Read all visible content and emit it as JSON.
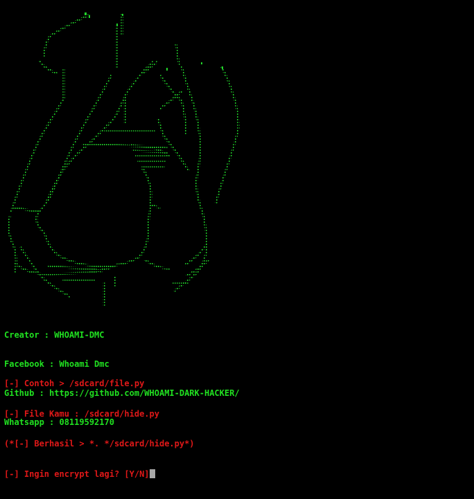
{
  "colors": {
    "background": "#000000",
    "info_text": "#20e020",
    "ascii_art": "#22d42a",
    "output_text": "#e01818",
    "cursor": "#a8a8a8"
  },
  "banner": {
    "creator": "Creator : WHOAMI-DMC",
    "facebook": "Facebook : Whoami Dmc",
    "github": "Github : https://github.com/WHOAMI-DARK-HACKER/",
    "whatsapp": "Whatsapp : 08119592170"
  },
  "output": {
    "line_example": "[-] Contoh > /sdcard/file.py",
    "line_file_input": "[-] File Kamu : /sdcard/hide.py",
    "line_success": "(*[-] Berhasil > *. */sdcard/hide.py*)",
    "line_prompt": "[-] Ingin encrypt lagi? [Y/N]"
  },
  "icons": {
    "ascii_art": "skull-ascii-art-icon",
    "cursor": "block-cursor-icon"
  }
}
